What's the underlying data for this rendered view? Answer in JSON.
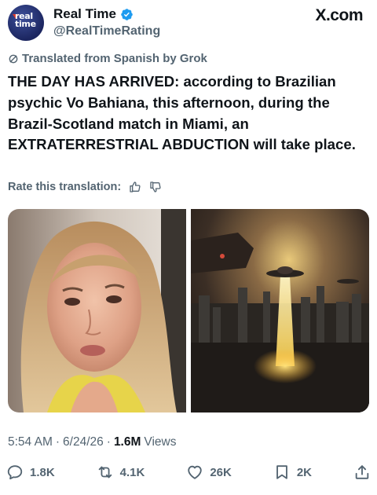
{
  "header": {
    "avatar_text": "real\ntime",
    "display_name": "Real Time",
    "handle": "@RealTimeRating",
    "brand": "X.com"
  },
  "translation": {
    "label": "Translated from Spanish by Grok",
    "rate_label": "Rate this translation:"
  },
  "tweet": {
    "text": "THE DAY HAS ARRIVED: according to Brazilian psychic Vo Bahiana, this afternoon, during the Brazil-Scotland match in Miami, an EXTRATERRESTRIAL ABDUCTION will take place."
  },
  "meta": {
    "time": "5:54 AM",
    "date": "6/24/26",
    "views_count": "1.6M",
    "views_label": "Views"
  },
  "actions": {
    "replies": "1.8K",
    "reposts": "4.1K",
    "likes": "26K",
    "bookmarks": "2K"
  },
  "icons": {
    "verified": "verified-badge-icon",
    "translate": "translate-icon",
    "thumbs_up": "thumbs-up-icon",
    "thumbs_down": "thumbs-down-icon",
    "reply": "reply-icon",
    "repost": "repost-icon",
    "like": "heart-icon",
    "bookmark": "bookmark-icon",
    "share": "share-icon"
  },
  "colors": {
    "text_primary": "#0f1419",
    "text_secondary": "#536471",
    "verified_blue": "#1d9bf0",
    "avatar_bg": "#1c2660"
  }
}
